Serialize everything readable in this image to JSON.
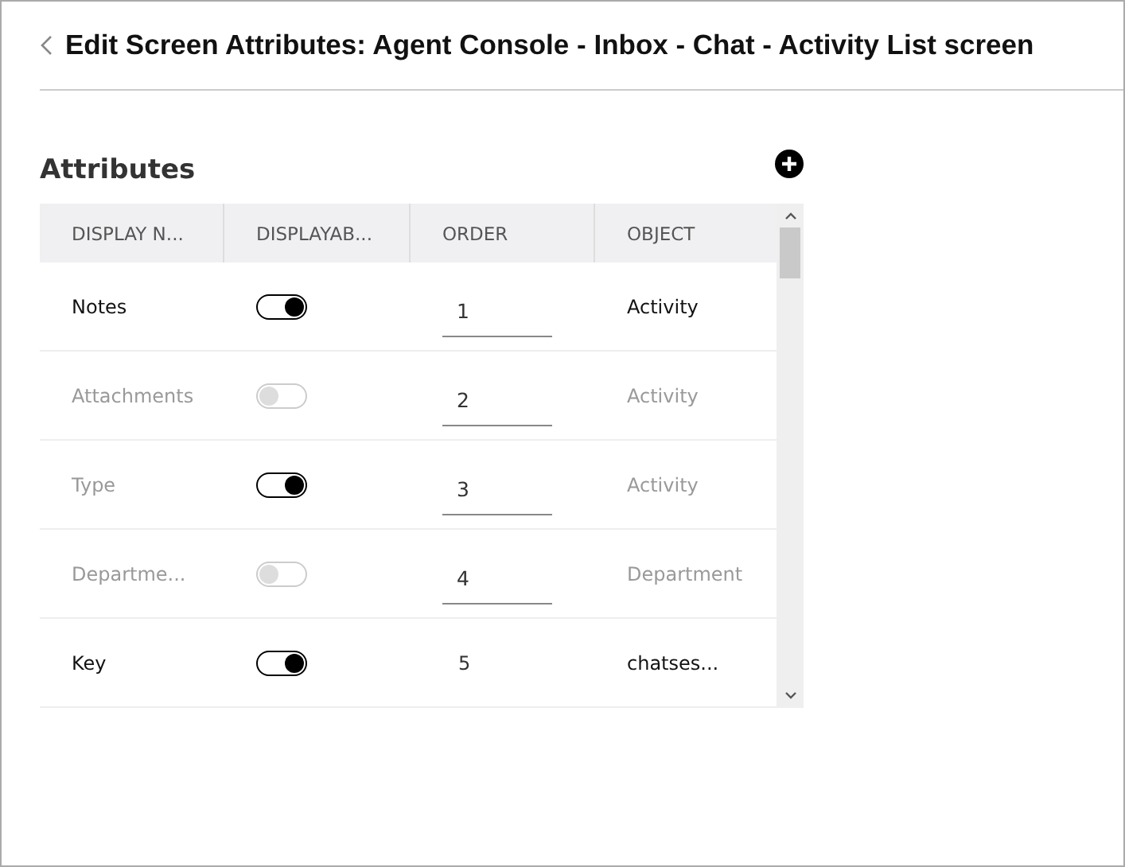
{
  "header": {
    "title": "Edit Screen Attributes: Agent Console - Inbox - Chat - Activity List screen"
  },
  "section": {
    "title": "Attributes"
  },
  "table": {
    "columns": [
      "DISPLAY N...",
      "DISPLAYAB...",
      "ORDER",
      "OBJECT"
    ],
    "rows": [
      {
        "name": "Notes",
        "muted": false,
        "displayable": true,
        "order": {
          "kind": "field",
          "value": "1"
        },
        "object": "Activity"
      },
      {
        "name": "Attachments",
        "muted": true,
        "displayable": false,
        "order": {
          "kind": "field",
          "value": "2"
        },
        "object": "Activity"
      },
      {
        "name": "Type",
        "muted": true,
        "displayable": true,
        "order": {
          "kind": "field",
          "value": "3"
        },
        "object": "Activity"
      },
      {
        "name": "Departme...",
        "muted": true,
        "displayable": false,
        "order": {
          "kind": "field",
          "value": "4"
        },
        "object": "Department"
      },
      {
        "name": "Key",
        "muted": false,
        "displayable": true,
        "order": {
          "kind": "text",
          "value": "5"
        },
        "object": "chatses..."
      }
    ]
  }
}
